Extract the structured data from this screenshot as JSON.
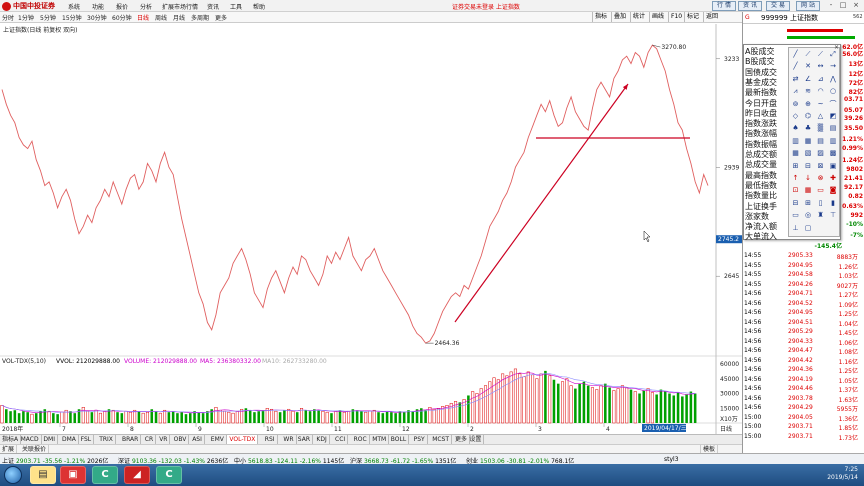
{
  "app": {
    "logo": "中国中投证券",
    "menus": [
      "系统",
      "功能",
      "报价",
      "分析",
      "扩展市场行情",
      "资讯",
      "工具",
      "帮助"
    ],
    "login_link": "证券交易未登录 上证指数",
    "top_buttons": [
      "行 情",
      "资 讯",
      "交 易",
      "网 站"
    ],
    "window_controls": [
      "-",
      "□",
      "×"
    ]
  },
  "toolbar": {
    "periods": [
      "分时",
      "1分钟",
      "5分钟",
      "15分钟",
      "30分钟",
      "60分钟",
      "日线",
      "周线",
      "月线",
      "多周期",
      "更多"
    ],
    "active": "日线",
    "right": [
      "指标",
      "叠加",
      "统计",
      "画线",
      "F10",
      "标记",
      "返回"
    ]
  },
  "chart": {
    "title": "上证指数(日线 前复权 双向)",
    "indicator_label": "VOL-TDX(5,10)",
    "vol_label": "VVOL: 212029888.00",
    "volume_label": "VOLUME: 212029888.00",
    "ma5_label": "MA5: 236380332.00",
    "ma10_label": "MA10: 262733280.00",
    "high_label": "3270.80",
    "low_label": "2464.36",
    "current_price": "2745.2",
    "price_axis": [
      "3233",
      "2939",
      "2645"
    ],
    "vol_axis": [
      "60000",
      "45000",
      "30000",
      "15000",
      "X10万"
    ],
    "date_label_left": "2018年",
    "date_cursor": "2019/04/17/三",
    "month_marks": [
      "7",
      "8",
      "9",
      "10",
      "11",
      "12",
      "2",
      "3",
      "4"
    ],
    "day_label": "日线",
    "price_series": [
      3150,
      3110,
      3080,
      3060,
      3020,
      3000,
      2990,
      3010,
      2960,
      2930,
      2890,
      2900,
      2870,
      2830,
      2860,
      2880,
      2850,
      2800,
      2760,
      2780,
      2810,
      2790,
      2830,
      2850,
      2880,
      2860,
      2900,
      2870,
      2840,
      2880,
      2910,
      2920,
      2880,
      2900,
      2950,
      2930,
      2900,
      2950,
      2980,
      2940,
      2920,
      2860,
      2800,
      2750,
      2700,
      2650,
      2600,
      2570,
      2520,
      2500,
      2540,
      2600,
      2620,
      2640,
      2680,
      2700,
      2720,
      2690,
      2650,
      2600,
      2580,
      2560,
      2610,
      2640,
      2660,
      2630,
      2600,
      2640,
      2670,
      2650,
      2700,
      2690,
      2660,
      2640,
      2620,
      2650,
      2700,
      2680,
      2710,
      2690,
      2720,
      2750,
      2700,
      2680,
      2660,
      2690,
      2700,
      2720,
      2690,
      2660,
      2640,
      2620,
      2600,
      2580,
      2560,
      2540,
      2510,
      2490,
      2480,
      2464,
      2470,
      2490,
      2520,
      2550,
      2570,
      2590,
      2600,
      2590,
      2620,
      2610,
      2640,
      2670,
      2700,
      2740,
      2780,
      2800,
      2820,
      2850,
      2870,
      2900,
      2940,
      2960,
      2980,
      3020,
      3050,
      3080,
      3110,
      3090,
      3120,
      3080,
      3050,
      3060,
      3100,
      3130,
      3090,
      3070,
      3050,
      3040,
      3100,
      3150,
      3170,
      3150,
      3130,
      3180,
      3200,
      3230,
      3240,
      3220,
      3250,
      3240,
      3210,
      3250,
      3270,
      3260,
      3230,
      3200,
      3150,
      3110,
      3060,
      3040,
      2990,
      2950,
      2900,
      2870,
      2920,
      2890
    ],
    "volumes": [
      18,
      14,
      12,
      13,
      10,
      12,
      11,
      9,
      10,
      12,
      14,
      12,
      10,
      9,
      11,
      13,
      12,
      10,
      14,
      16,
      12,
      11,
      13,
      10,
      12,
      14,
      13,
      11,
      10,
      12,
      11,
      13,
      12,
      10,
      11,
      14,
      12,
      10,
      13,
      11,
      12,
      10,
      11,
      9,
      10,
      12,
      11,
      10,
      12,
      14,
      16,
      13,
      12,
      11,
      10,
      12,
      14,
      15,
      13,
      11,
      12,
      13,
      15,
      14,
      12,
      11,
      13,
      14,
      12,
      11,
      15,
      13,
      12,
      14,
      13,
      12,
      11,
      10,
      12,
      13,
      11,
      12,
      14,
      13,
      12,
      11,
      12,
      13,
      11,
      10,
      12,
      11,
      10,
      12,
      11,
      13,
      12,
      14,
      15,
      13,
      16,
      14,
      15,
      17,
      18,
      20,
      22,
      21,
      24,
      28,
      32,
      30,
      35,
      38,
      42,
      46,
      44,
      50,
      48,
      52,
      55,
      50,
      47,
      52,
      49,
      45,
      50,
      53,
      48,
      44,
      40,
      42,
      45,
      38,
      35,
      40,
      42,
      38,
      36,
      34,
      38,
      40,
      36,
      33,
      35,
      38,
      36,
      34,
      32,
      30,
      33,
      35,
      31,
      29,
      34,
      32,
      30,
      28,
      31,
      27,
      29,
      32,
      30
    ],
    "trendline": {
      "from": [
        455,
        322
      ],
      "to": [
        628,
        84
      ]
    },
    "hline": {
      "from": [
        536,
        138
      ],
      "to": [
        690,
        138
      ]
    }
  },
  "right_panel": {
    "g_marker": "G",
    "code": "999999 上证指数",
    "number": "562",
    "labels": [
      "A股成交",
      "B股成交",
      "国债成交",
      "基金成交",
      "最新指数",
      "今日开盘",
      "昨日收盘",
      "指数涨跌",
      "指数涨幅",
      "指数振幅",
      "总成交额",
      "总成交量",
      "最高指数",
      "最低指数",
      "指数量比",
      "上证换手",
      "涨家数",
      "净流入额",
      "大单流入"
    ],
    "values": [
      "62.0亿",
      "56.0亿",
      "13亿",
      "12亿",
      "72亿",
      "82亿",
      "03.71",
      "05.07",
      "39.26",
      "35.50",
      "1.21%",
      "0.99%",
      "1.24亿",
      "9802",
      "21.41",
      "92.17",
      "0.82",
      "0.63%",
      "992",
      "-10%",
      "-7%"
    ],
    "net_inflow": "-145.4亿",
    "net_inflow_pct": "-7%",
    "ticks": [
      {
        "time": "14:55",
        "price": "2905.33",
        "vol": "8883万"
      },
      {
        "time": "14:55",
        "price": "2904.95",
        "vol": "1.26亿"
      },
      {
        "time": "14:55",
        "price": "2904.58",
        "vol": "1.03亿"
      },
      {
        "time": "14:55",
        "price": "2904.26",
        "vol": "9027万"
      },
      {
        "time": "14:56",
        "price": "2904.71",
        "vol": "1.27亿"
      },
      {
        "time": "14:56",
        "price": "2904.52",
        "vol": "1.09亿"
      },
      {
        "time": "14:56",
        "price": "2904.95",
        "vol": "1.25亿"
      },
      {
        "time": "14:56",
        "price": "2904.51",
        "vol": "1.04亿"
      },
      {
        "time": "14:56",
        "price": "2905.29",
        "vol": "1.45亿"
      },
      {
        "time": "14:56",
        "price": "2904.33",
        "vol": "1.06亿"
      },
      {
        "time": "14:56",
        "price": "2904.47",
        "vol": "1.08亿"
      },
      {
        "time": "14:56",
        "price": "2904.42",
        "vol": "1.16亿"
      },
      {
        "time": "14:56",
        "price": "2904.36",
        "vol": "1.25亿"
      },
      {
        "time": "14:56",
        "price": "2904.19",
        "vol": "1.05亿"
      },
      {
        "time": "14:56",
        "price": "2904.46",
        "vol": "1.37亿"
      },
      {
        "time": "14:56",
        "price": "2903.78",
        "vol": "1.63亿"
      },
      {
        "time": "14:56",
        "price": "2904.29",
        "vol": "5955万"
      },
      {
        "time": "15:00",
        "price": "2904.05",
        "vol": "1.36亿"
      },
      {
        "time": "15:00",
        "price": "2903.71",
        "vol": "1.85亿"
      },
      {
        "time": "15:00",
        "price": "2903.71",
        "vol": "1.73亿"
      }
    ]
  },
  "palette": {
    "tools": [
      "╱",
      "⟋",
      "⟋",
      "⤢",
      "╱",
      "✕",
      "↔",
      "→",
      "⇄",
      "∠",
      "⊿",
      "⋀",
      "⩘",
      "≋",
      "◠",
      "○",
      "⊚",
      "⊕",
      "~",
      "⌒",
      "◇",
      "⌬",
      "△",
      "◩",
      "♠",
      "♣",
      "▒",
      "▤",
      "▥",
      "▦",
      "▤",
      "▥",
      "▦",
      "▧",
      "▨",
      "▩",
      "⊞",
      "⊟",
      "⊠",
      "▣",
      "↑",
      "↓",
      "⊗",
      "✚",
      "⊡",
      "▦",
      "▭",
      "◙",
      "⊟",
      "⊞",
      "▯",
      "▮",
      "▭",
      "◎",
      "♜",
      "⊤",
      "⊥",
      "▢"
    ]
  },
  "indicator_tabs": [
    "指标A",
    "MACD",
    "DMI",
    "DMA",
    "FSL",
    "TRIX",
    "BRAR",
    "CR",
    "VR",
    "OBV",
    "ASI",
    "EMV",
    "VOL-TDX",
    "RSI",
    "WR",
    "SAR",
    "KDJ",
    "CCI",
    "ROC",
    "MTM",
    "BOLL",
    "PSY",
    "MCST",
    "更多",
    "设置"
  ],
  "active_indicator": "VOL-TDX",
  "sub_tabs": [
    "扩展",
    "关联报价"
  ],
  "right_tab": "模板",
  "status_bar": [
    {
      "name": "上证",
      "value": "2903.71",
      "chg": "-35.56",
      "pct": "-1.21%",
      "amt": "2026亿"
    },
    {
      "name": "深证",
      "value": "9103.36",
      "chg": "-132.03",
      "pct": "-1.43%",
      "amt": "2636亿"
    },
    {
      "name": "中小",
      "value": "5618.83",
      "chg": "-124.11",
      "pct": "-2.16%",
      "amt": "1145亿"
    },
    {
      "name": "沪深",
      "value": "3668.73",
      "chg": "-61.72",
      "pct": "-1.65%",
      "amt": "1351亿"
    },
    {
      "name": "创业",
      "value": "1503.06",
      "chg": "-30.81",
      "pct": "-2.01%",
      "amt": "768.1亿"
    }
  ],
  "status_extra": "styl3",
  "taskbar": {
    "time": "7:25",
    "date": "2019/5/14"
  },
  "colors": {
    "up": "#dd0000",
    "down": "#008800",
    "price_line": "#e06060",
    "ma": "#cc00cc",
    "annotation": "#cc0022"
  }
}
